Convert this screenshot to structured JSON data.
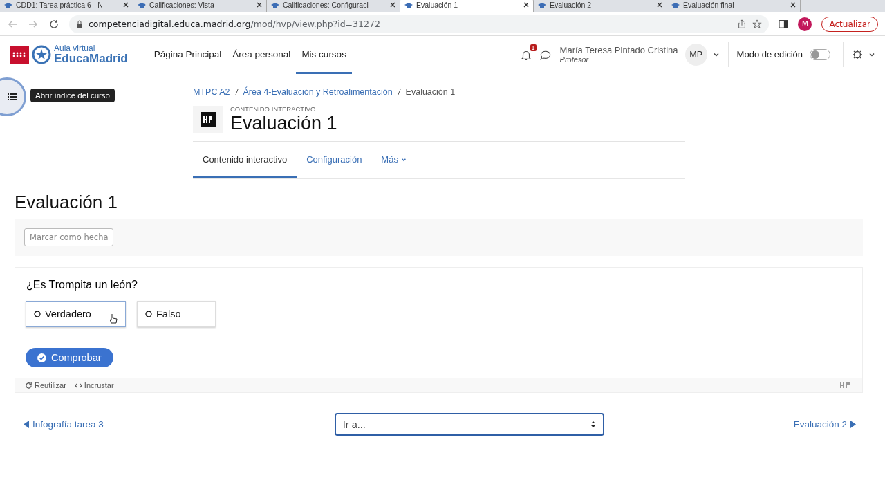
{
  "browser": {
    "tabs": [
      {
        "title": "CDD1: Tarea práctica 6 - N",
        "selected": false
      },
      {
        "title": "Calificaciones: Vista",
        "selected": false
      },
      {
        "title": "Calificaciones: Configuraci",
        "selected": false
      },
      {
        "title": "Evaluación 1",
        "selected": true
      },
      {
        "title": "Evaluación 2",
        "selected": false
      },
      {
        "title": "Evaluación final",
        "selected": false
      }
    ],
    "url_host": "competenciadigital.educa.madrid.org",
    "url_path": "/mod/hvp/view.php?id=31272",
    "profile_initial": "M",
    "update_button": "Actualizar"
  },
  "navbar": {
    "logo_small": "Aula virtual",
    "logo_big": "EducaMadrid",
    "links": [
      {
        "label": "Página Principal",
        "selected": false
      },
      {
        "label": "Área personal",
        "selected": false
      },
      {
        "label": "Mis cursos",
        "selected": true
      }
    ],
    "notification_count": "1",
    "user_name": "María Teresa Pintado Cristina",
    "user_role": "Profesor",
    "avatar_initials": "MP",
    "edit_mode_label": "Modo de edición",
    "edit_mode_on": false
  },
  "course_index_tooltip": "Abrir índice del curso",
  "breadcrumb": [
    "MTPC A2",
    "Área 4-Evaluación y Retroalimentación",
    "Evaluación 1"
  ],
  "activity": {
    "type_label": "CONTENIDO INTERACTIVO",
    "title": "Evaluación 1"
  },
  "secondary_tabs": [
    {
      "label": "Contenido interactivo",
      "selected": true
    },
    {
      "label": "Configuración",
      "selected": false
    },
    {
      "label": "Más",
      "selected": false
    }
  ],
  "page_heading": "Evaluación 1",
  "mark_done_button": "Marcar como hecha",
  "quiz": {
    "question": "¿Es Trompita un león?",
    "options": [
      {
        "label": "Verdadero",
        "selected": false,
        "hovered": true
      },
      {
        "label": "Falso",
        "selected": false,
        "hovered": false
      }
    ],
    "check_button": "Comprobar",
    "footer_links": [
      {
        "kind": "reuse",
        "label": "Reutilizar"
      },
      {
        "kind": "embed",
        "label": "Incrustar"
      }
    ]
  },
  "footer_nav": {
    "previous": "Infografía tarea 3",
    "jump_placeholder": "Ir a...",
    "next": "Evaluación 2"
  }
}
